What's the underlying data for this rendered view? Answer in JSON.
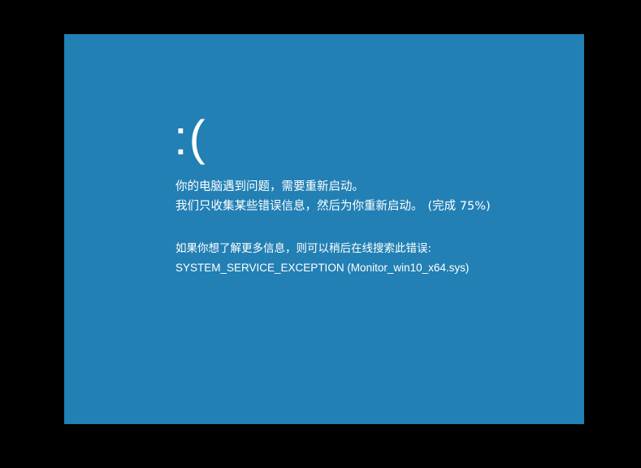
{
  "screen": {
    "background_color": "#2280b4",
    "frown": ":(",
    "message_line1": "你的电脑遇到问题，需要重新启动。",
    "message_line2": "我们只收集某些错误信息，然后为你重新启动。",
    "progress": "(完成 75%)",
    "progress_percent": 75,
    "info_line": "如果你想了解更多信息，则可以稍后在线搜索此错误:",
    "stop_code": "SYSTEM_SERVICE_EXCEPTION (Monitor_win10_x64.sys)"
  }
}
